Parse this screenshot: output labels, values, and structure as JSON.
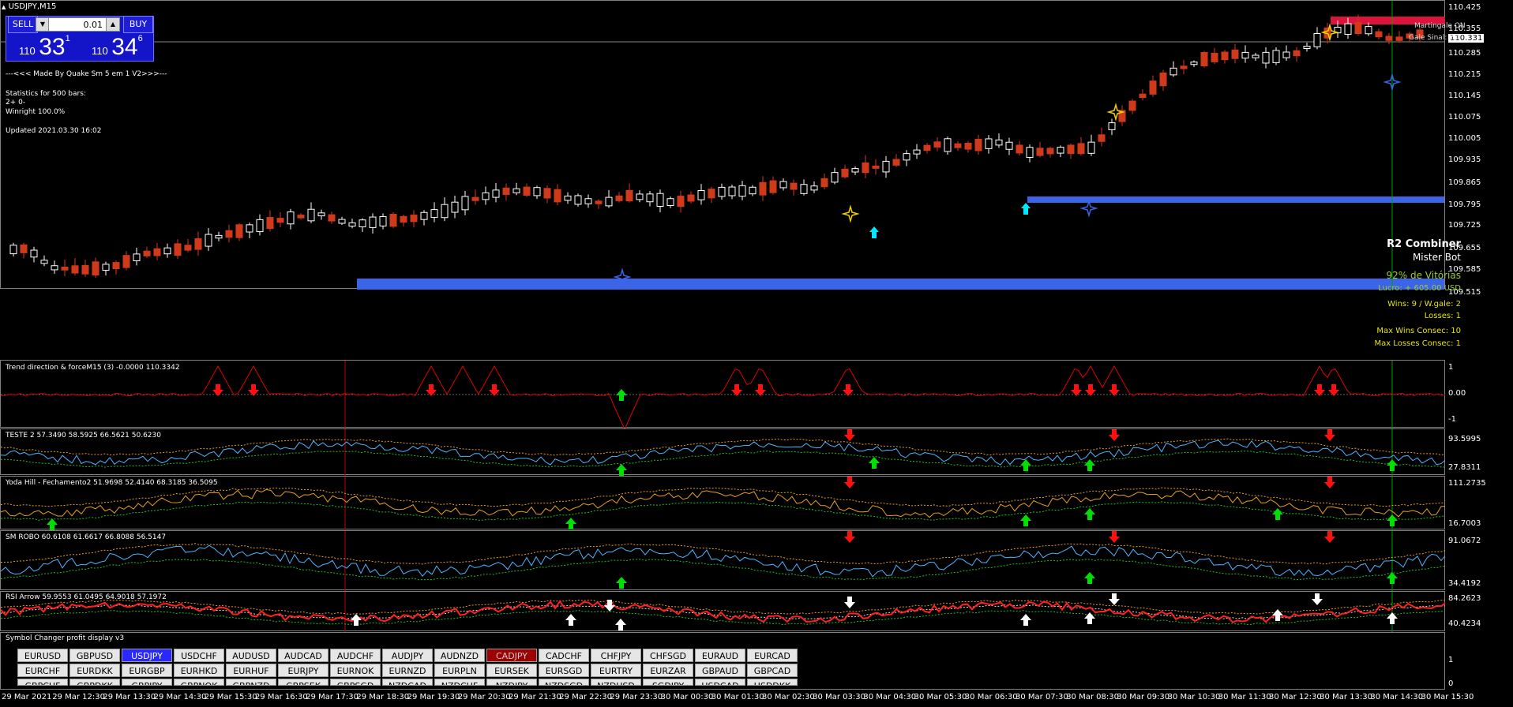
{
  "window": {
    "title": "USDJPY,M15"
  },
  "trade_panel": {
    "sell_label": "SELL",
    "buy_label": "BUY",
    "lot": "0.01",
    "bid_prefix": "110",
    "bid_big": "33",
    "bid_sup": "1",
    "ask_prefix": "110",
    "ask_big": "34",
    "ask_sup": "6",
    "up_arrow": "▲",
    "down_arrow": "▼"
  },
  "info": {
    "made_by": "---<<< Made By Quake Sm 5 em 1 V2>>>---",
    "stats_title": "Statistics for 500 bars:",
    "stats_line1": "2+  0-",
    "winright": "Winright 100.0%",
    "updated": "Updated 2021.03.30 16:02"
  },
  "top_right": {
    "martingale": "Martingale ON",
    "gale": "Gale Sinal: 2.0"
  },
  "panel": {
    "title": "R2 Combiner",
    "subtitle": "Mister Bot",
    "win_pct": "92% de Vitórias",
    "lucro": "Lucro: + 605.00 USD",
    "wins": "Wins: 9 / W.gale: 2",
    "losses": "Losses: 1",
    "max_wins": "Max Wins Consec: 10",
    "max_losses": "Max Losses Consec: 1"
  },
  "main_axis": [
    "110.425",
    "110.355",
    "110.331",
    "110.285",
    "110.215",
    "110.145",
    "110.075",
    "110.005",
    "109.935",
    "109.865",
    "109.795",
    "109.725",
    "109.655",
    "109.585",
    "109.515"
  ],
  "indicators": [
    {
      "name": "Trend direction & forceM15 (3) -0.0000 110.3342",
      "axis": [
        "1",
        "0.00",
        "-1"
      ]
    },
    {
      "name": "TESTE 2 57.3490 58.5925 66.5621 50.6230",
      "axis": [
        "93.5995",
        "27.8311"
      ]
    },
    {
      "name": "Yoda Hill - Fechamento2 51.9698 52.4140 68.3185 36.5095",
      "axis": [
        "111.2735",
        "16.7003"
      ]
    },
    {
      "name": "SM ROBO 60.6108 61.6617 66.8088 56.5147",
      "axis": [
        "91.0672",
        "34.4192"
      ]
    },
    {
      "name": "RSI Arrow 59.9553 61.0495 64.9018 57.1972",
      "axis": [
        "84.2623",
        "40.4234"
      ]
    },
    {
      "name": "Symbol Changer profit display v3",
      "axis": [
        "1",
        "0"
      ]
    }
  ],
  "symbols": [
    [
      "EURUSD",
      "GBPUSD",
      "USDJPY",
      "USDCHF",
      "AUDUSD",
      "AUDCAD",
      "AUDCHF",
      "AUDJPY",
      "AUDNZD",
      "CADJPY",
      "CADCHF",
      "CHFJPY",
      "CHFSGD",
      "EURAUD",
      "EURCAD"
    ],
    [
      "EURCHF",
      "EURDKK",
      "EURGBP",
      "EURHKD",
      "EURHUF",
      "EURJPY",
      "EURNOK",
      "EURNZD",
      "EURPLN",
      "EURSEK",
      "EURSGD",
      "EURTRY",
      "EURZAR",
      "GBPAUD",
      "GBPCAD"
    ],
    [
      "GBPCHF",
      "GBPDKK",
      "GBPJPY",
      "GBPNOK",
      "GBPNZD",
      "GBPSEK",
      "GBPSGD",
      "NZDCAD",
      "NZDCHF",
      "NZDJPY",
      "NZDSGD",
      "NZDUSD",
      "SGDJPY",
      "USDCAD",
      "USDDKK"
    ]
  ],
  "time_axis": [
    "29 Mar 2021",
    "29 Mar 12:30",
    "29 Mar 13:30",
    "29 Mar 14:30",
    "29 Mar 15:30",
    "29 Mar 16:30",
    "29 Mar 17:30",
    "29 Mar 18:30",
    "29 Mar 19:30",
    "29 Mar 20:30",
    "29 Mar 21:30",
    "29 Mar 22:30",
    "29 Mar 23:30",
    "30 Mar 00:30",
    "30 Mar 01:30",
    "30 Mar 02:30",
    "30 Mar 03:30",
    "30 Mar 04:30",
    "30 Mar 05:30",
    "30 Mar 06:30",
    "30 Mar 07:30",
    "30 Mar 08:30",
    "30 Mar 09:30",
    "30 Mar 10:30",
    "30 Mar 11:30",
    "30 Mar 12:30",
    "30 Mar 13:30",
    "30 Mar 14:30",
    "30 Mar 15:30"
  ],
  "colors": {
    "bull": "#ffffff",
    "bear": "#d03a1a",
    "zone": "#3c64e6",
    "accent_yellow": "#f0d000",
    "green_arrow": "#00e000",
    "red_arrow": "#ff1010",
    "cyan": "#00e8ff"
  }
}
